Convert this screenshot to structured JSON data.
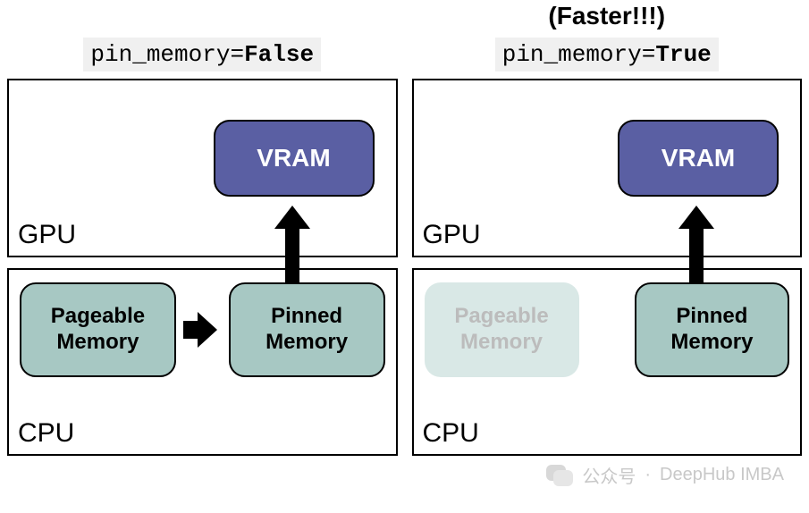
{
  "left": {
    "code_prefix": "pin_memory=",
    "code_value": "False",
    "gpu_label": "GPU",
    "cpu_label": "CPU",
    "vram": "VRAM",
    "pageable": "Pageable\nMemory",
    "pinned": "Pinned\nMemory"
  },
  "right": {
    "faster": "(Faster!!!)",
    "code_prefix": "pin_memory=",
    "code_value": "True",
    "gpu_label": "GPU",
    "cpu_label": "CPU",
    "vram": "VRAM",
    "pageable": "Pageable\nMemory",
    "pinned": "Pinned\nMemory"
  },
  "watermark": {
    "label": "公众号",
    "brand": "DeepHub IMBA"
  },
  "colors": {
    "vram_bg": "#5a5fa3",
    "mem_bg": "#a7c8c3",
    "mem_faded_bg": "#d9e8e6",
    "code_bg": "#f0f0f0"
  }
}
